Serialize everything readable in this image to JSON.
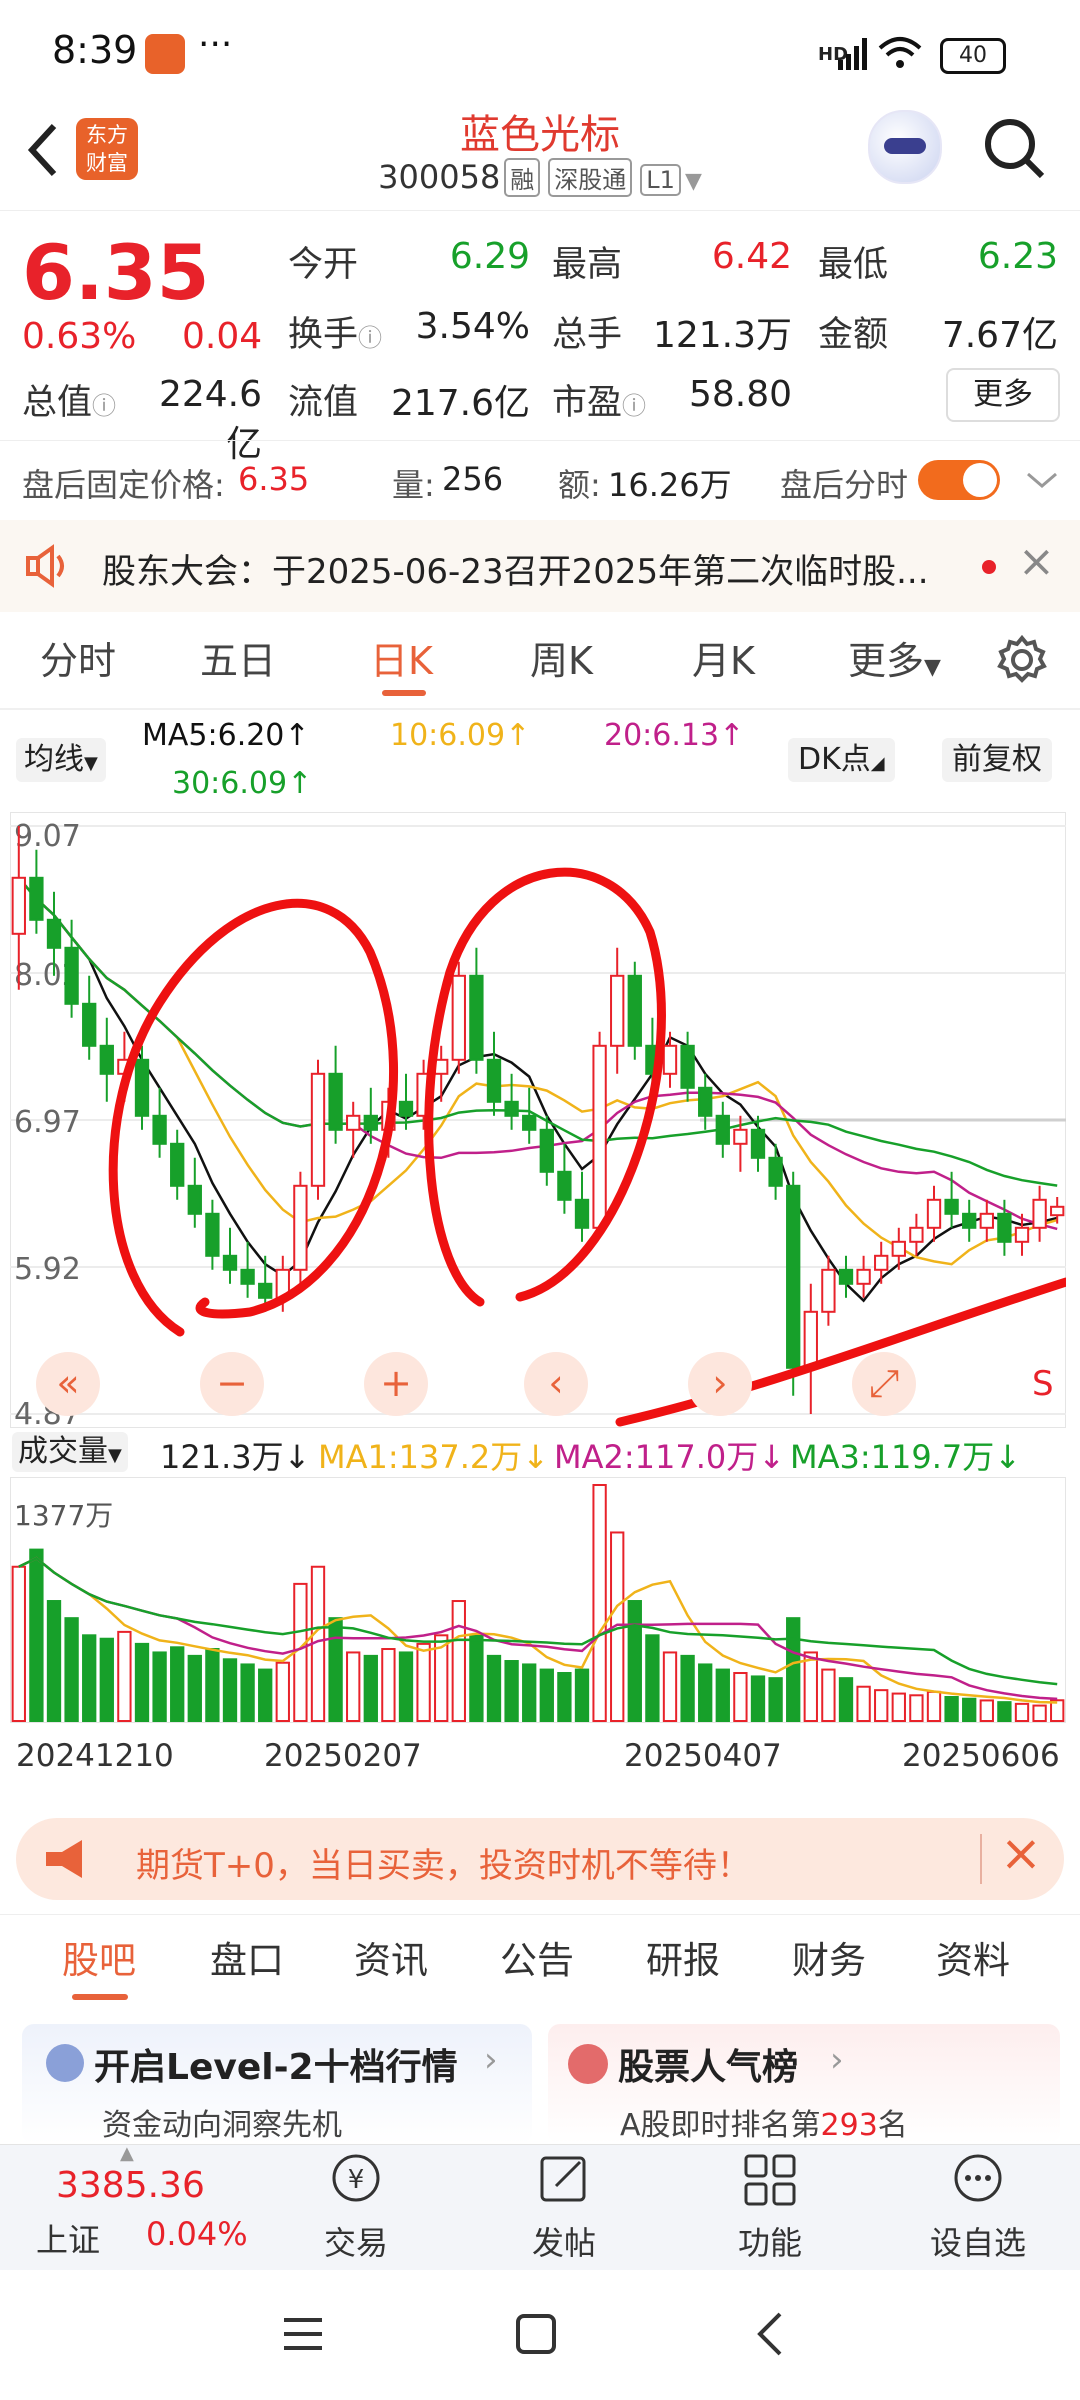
{
  "status_bar": {
    "time": "8:39",
    "network": "HD",
    "battery": "40"
  },
  "header": {
    "title": "蓝色光标",
    "code": "300058",
    "tags": [
      "融",
      "深股通",
      "L1"
    ],
    "logo_text": "东方财富"
  },
  "quote": {
    "price": "6.35",
    "change_pct": "0.63%",
    "change": "0.04",
    "rows": [
      [
        {
          "label": "今开",
          "value": "6.29",
          "color": "#17a02a"
        },
        {
          "label": "最高",
          "value": "6.42",
          "color": "#e8222a"
        },
        {
          "label": "最低",
          "value": "6.23",
          "color": "#17a02a"
        }
      ],
      [
        {
          "label": "换手",
          "value": "3.54%",
          "color": "#222"
        },
        {
          "label": "总手",
          "value": "121.3万",
          "color": "#222"
        },
        {
          "label": "金额",
          "value": "7.67亿",
          "color": "#222"
        }
      ],
      [
        {
          "label": "总值",
          "value": "224.6亿",
          "color": "#222"
        },
        {
          "label": "流值",
          "value": "217.6亿",
          "color": "#222"
        },
        {
          "label": "市盈",
          "value": "58.80",
          "color": "#222"
        }
      ]
    ],
    "more_button": "更多",
    "after_hours": {
      "price_label": "盘后固定价格:",
      "price": "6.35",
      "vol_label": "量:",
      "vol": "256",
      "amt_label": "额:",
      "amt": "16.26万",
      "toggle_label": "盘后分时"
    }
  },
  "notice": {
    "text": "股东大会：于2025-06-23召开2025年第二次临时股..."
  },
  "chart_tabs": [
    "分时",
    "五日",
    "日K",
    "周K",
    "月K",
    "更多"
  ],
  "active_tab": "日K",
  "ma_legend": {
    "selector": "均线",
    "ma5": "MA5:6.20",
    "ma10": "10:6.09",
    "ma20": "20:6.13",
    "ma30": "30:6.09",
    "dk": "DK点",
    "adjust": "前复权"
  },
  "volume_legend": {
    "selector": "成交量",
    "vol": "121.3万",
    "ma1": "MA1:137.2万",
    "ma2": "MA2:117.0万",
    "ma3": "MA3:119.7万",
    "ymax": "1377万"
  },
  "chart_controls": [
    "«",
    "−",
    "+",
    "‹",
    "⤢",
    "S"
  ],
  "ad": {
    "text": "期货T+0，当日买卖，投资时机不等待！"
  },
  "bottom_tabs": [
    "股吧",
    "盘口",
    "资讯",
    "公告",
    "研报",
    "财务",
    "资料"
  ],
  "active_bottom_tab": "股吧",
  "promos": [
    {
      "title": "开启Level-2十档行情",
      "sub": "资金动向洞察先机"
    },
    {
      "title": "股票人气榜",
      "sub_pre": "A股即时排名第",
      "rank": "293",
      "sub_post": "名"
    }
  ],
  "toolbar": {
    "index_value": "3385.36",
    "index_name": "上证",
    "index_change": "0.04%",
    "items": [
      "交易",
      "发帖",
      "功能",
      "设自选"
    ]
  },
  "colors": {
    "up": "#e8222a",
    "down": "#17a02a",
    "ma5": "#111111",
    "ma10": "#f0b31a",
    "ma20": "#c0208a",
    "ma30": "#17a02a",
    "accent": "#e8623a"
  },
  "chart_data": {
    "type": "candlestick",
    "x_ticks": [
      "20241210",
      "20250207",
      "20250407",
      "20250606"
    ],
    "y_ticks": [
      "9.07",
      "8.02",
      "6.97",
      "5.92",
      "4.87"
    ],
    "ylim": [
      4.87,
      9.07
    ],
    "candles": [
      [
        8.3,
        9.07,
        7.9,
        8.7
      ],
      [
        8.7,
        8.9,
        8.3,
        8.4
      ],
      [
        8.4,
        8.6,
        8.0,
        8.2
      ],
      [
        8.2,
        8.4,
        7.7,
        7.8
      ],
      [
        7.8,
        8.0,
        7.4,
        7.5
      ],
      [
        7.5,
        7.7,
        7.1,
        7.3
      ],
      [
        7.3,
        7.6,
        7.1,
        7.4
      ],
      [
        7.4,
        7.5,
        6.9,
        7.0
      ],
      [
        7.0,
        7.2,
        6.7,
        6.8
      ],
      [
        6.8,
        6.9,
        6.4,
        6.5
      ],
      [
        6.5,
        6.7,
        6.2,
        6.3
      ],
      [
        6.3,
        6.4,
        5.9,
        6.0
      ],
      [
        6.0,
        6.2,
        5.8,
        5.9
      ],
      [
        5.9,
        6.1,
        5.7,
        5.8
      ],
      [
        5.8,
        6.0,
        5.6,
        5.7
      ],
      [
        5.7,
        6.0,
        5.6,
        5.9
      ],
      [
        5.9,
        6.6,
        5.8,
        6.5
      ],
      [
        6.5,
        7.4,
        6.4,
        7.3
      ],
      [
        7.3,
        7.5,
        6.8,
        6.9
      ],
      [
        6.9,
        7.1,
        6.7,
        7.0
      ],
      [
        7.0,
        7.2,
        6.8,
        6.9
      ],
      [
        6.9,
        7.2,
        6.7,
        7.1
      ],
      [
        7.1,
        7.3,
        6.9,
        7.0
      ],
      [
        7.0,
        7.4,
        6.9,
        7.3
      ],
      [
        7.3,
        7.5,
        7.1,
        7.4
      ],
      [
        7.4,
        8.1,
        7.3,
        8.0
      ],
      [
        8.0,
        8.2,
        7.3,
        7.4
      ],
      [
        7.4,
        7.6,
        7.0,
        7.1
      ],
      [
        7.1,
        7.3,
        6.9,
        7.0
      ],
      [
        7.0,
        7.2,
        6.8,
        6.9
      ],
      [
        6.9,
        7.0,
        6.5,
        6.6
      ],
      [
        6.6,
        6.8,
        6.3,
        6.4
      ],
      [
        6.4,
        6.6,
        6.1,
        6.2
      ],
      [
        6.2,
        7.6,
        6.2,
        7.5
      ],
      [
        7.5,
        8.2,
        7.3,
        8.0
      ],
      [
        8.0,
        8.1,
        7.4,
        7.5
      ],
      [
        7.5,
        7.7,
        7.2,
        7.3
      ],
      [
        7.3,
        7.6,
        7.2,
        7.5
      ],
      [
        7.5,
        7.6,
        7.1,
        7.2
      ],
      [
        7.2,
        7.3,
        6.9,
        7.0
      ],
      [
        7.0,
        7.1,
        6.7,
        6.8
      ],
      [
        6.8,
        7.0,
        6.6,
        6.9
      ],
      [
        6.9,
        7.0,
        6.6,
        6.7
      ],
      [
        6.7,
        6.8,
        6.4,
        6.5
      ],
      [
        6.5,
        6.6,
        5.0,
        5.2
      ],
      [
        5.2,
        5.8,
        4.87,
        5.6
      ],
      [
        5.6,
        6.0,
        5.5,
        5.9
      ],
      [
        5.9,
        6.0,
        5.7,
        5.8
      ],
      [
        5.8,
        6.0,
        5.7,
        5.9
      ],
      [
        5.9,
        6.1,
        5.8,
        6.0
      ],
      [
        6.0,
        6.2,
        5.9,
        6.1
      ],
      [
        6.1,
        6.3,
        6.0,
        6.2
      ],
      [
        6.2,
        6.5,
        6.1,
        6.4
      ],
      [
        6.4,
        6.6,
        6.2,
        6.3
      ],
      [
        6.3,
        6.4,
        6.1,
        6.2
      ],
      [
        6.2,
        6.4,
        6.1,
        6.3
      ],
      [
        6.3,
        6.4,
        6.0,
        6.1
      ],
      [
        6.1,
        6.3,
        6.0,
        6.2
      ],
      [
        6.2,
        6.5,
        6.1,
        6.4
      ],
      [
        6.29,
        6.42,
        6.23,
        6.35
      ]
    ],
    "volume_max": 1377,
    "volumes": [
      900,
      1000,
      700,
      600,
      500,
      480,
      520,
      450,
      400,
      430,
      380,
      420,
      360,
      330,
      300,
      340,
      800,
      900,
      600,
      400,
      380,
      420,
      400,
      450,
      500,
      700,
      500,
      380,
      350,
      330,
      300,
      280,
      300,
      1377,
      1100,
      700,
      500,
      400,
      380,
      330,
      300,
      280,
      260,
      250,
      600,
      400,
      300,
      250,
      200,
      180,
      160,
      150,
      170,
      140,
      130,
      120,
      110,
      100,
      90,
      121
    ]
  }
}
